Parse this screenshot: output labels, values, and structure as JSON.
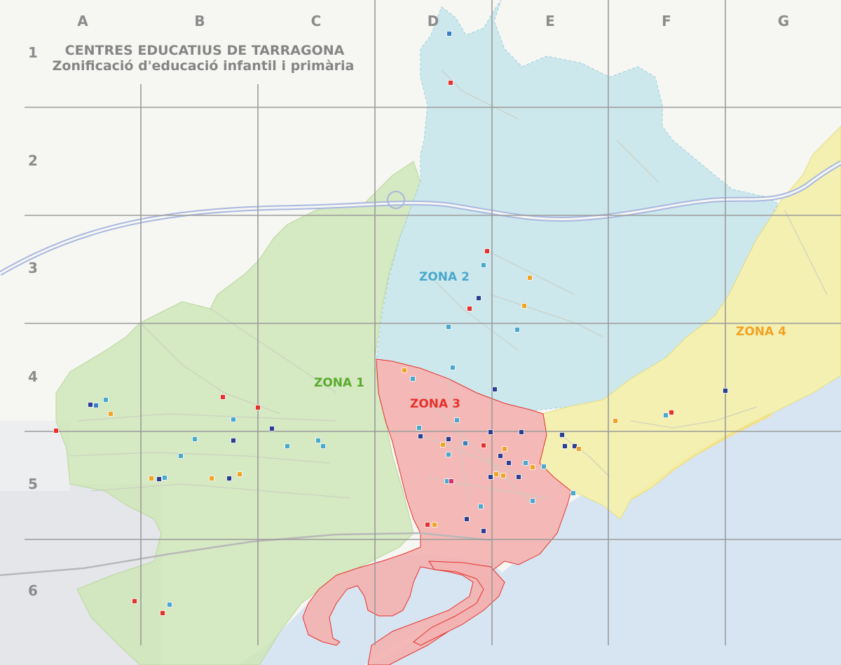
{
  "title": {
    "line1": "CENTRES EDUCATIUS DE TARRAGONA",
    "line2": "Zonificació d'educació infantil i primària"
  },
  "grid": {
    "columns": [
      "A",
      "B",
      "C",
      "D",
      "E",
      "F",
      "G"
    ],
    "rows": [
      "1",
      "2",
      "3",
      "4",
      "5",
      "6"
    ]
  },
  "zones": [
    {
      "id": "zona-1",
      "label": "ZONA 1",
      "color": "#5aab2e",
      "fill": "#cfe6b8"
    },
    {
      "id": "zona-2",
      "label": "ZONA 2",
      "color": "#4aa8cc",
      "fill": "#c9e6ec"
    },
    {
      "id": "zona-3",
      "label": "ZONA 3",
      "color": "#e5322d",
      "fill": "#f3b3b2"
    },
    {
      "id": "zona-4",
      "label": "ZONA 4",
      "color": "#f0a325",
      "fill": "#f3eeaa"
    }
  ],
  "colors": {
    "sea": "#d7e5f2",
    "land": "#f6f7f3",
    "highway": "#a9b7df",
    "grid": "#9b9b9b",
    "beach": "#f7e08a"
  },
  "markers": [
    {
      "icon": "school-pin-icon",
      "n": "1",
      "color": "#e5322d"
    },
    {
      "icon": "school-pin-icon",
      "n": "2",
      "color": "#3a7fc1"
    },
    {
      "icon": "school-pin-icon",
      "n": "3",
      "color": "#f0a325"
    },
    {
      "icon": "school-pin-icon",
      "n": "4",
      "color": "#2c3e8f"
    },
    {
      "icon": "school-pin-icon",
      "n": "5",
      "color": "#4aa8cc"
    },
    {
      "icon": "school-pin-icon",
      "n": "6",
      "color": "#d6306d"
    }
  ]
}
